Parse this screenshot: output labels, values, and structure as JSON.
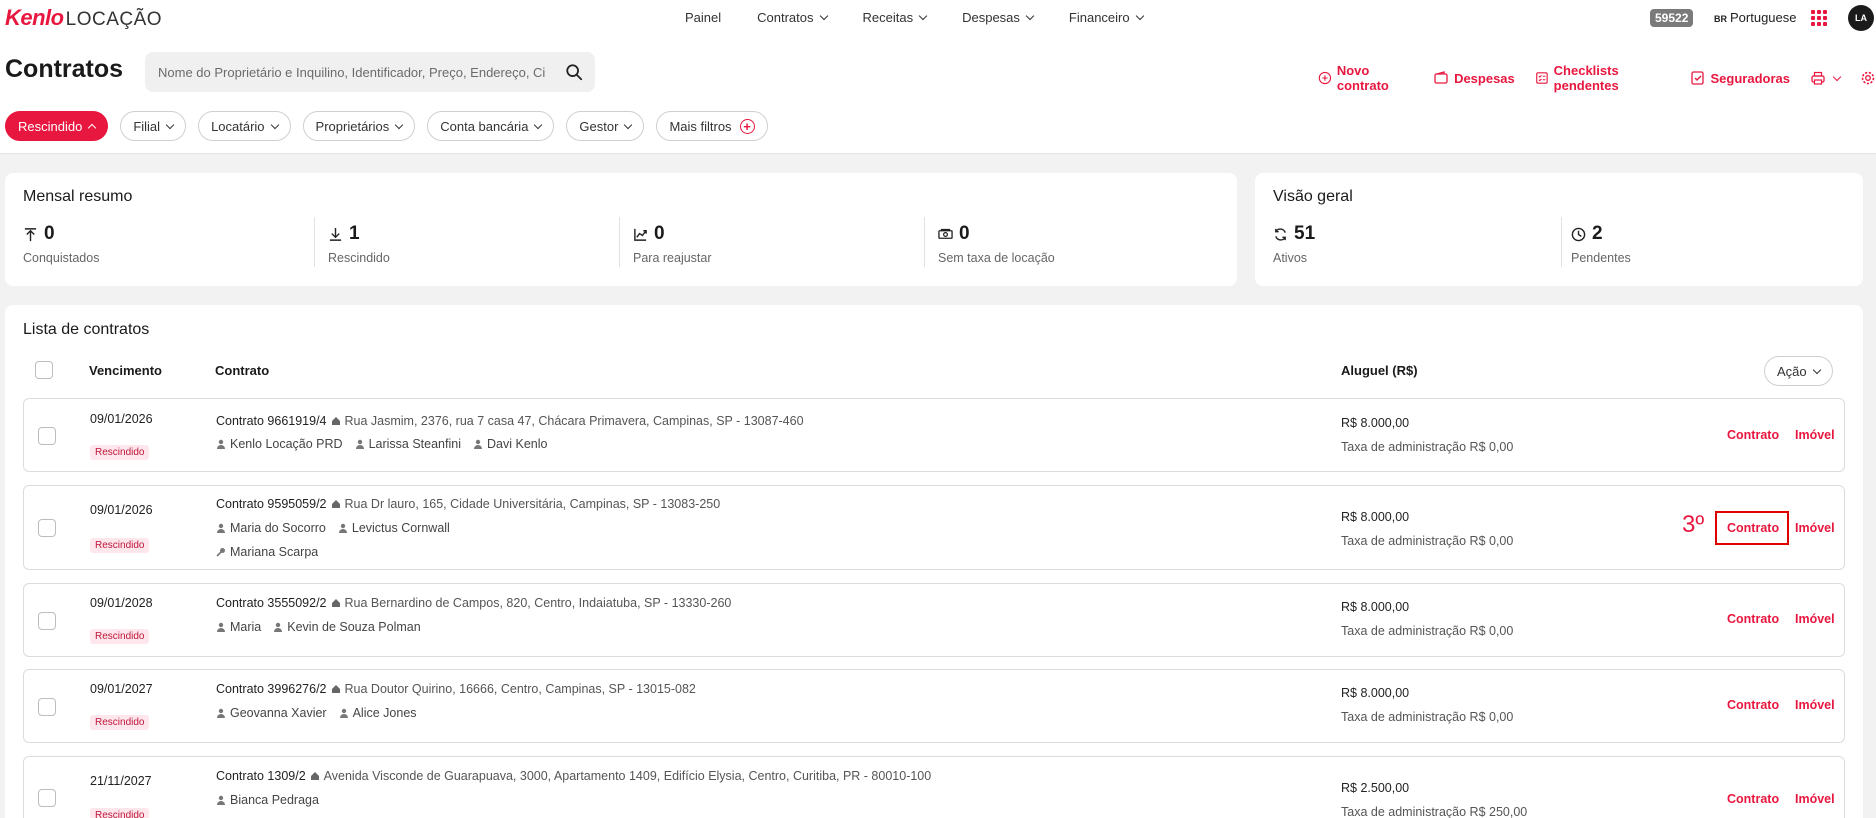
{
  "brand": {
    "logo_part1": "Kenlo",
    "logo_part2": "LOCAÇÃO"
  },
  "nav": [
    "Painel",
    "Contratos",
    "Receitas",
    "Despesas",
    "Financeiro"
  ],
  "account": {
    "id": "59522",
    "lang_code": "BR",
    "lang": "Portuguese",
    "avatar": "LA"
  },
  "page": {
    "title": "Contratos",
    "search_placeholder": "Nome do Proprietário e Inquilino, Identificador, Preço, Endereço, Cidade",
    "actions": [
      "Novo contrato",
      "Despesas",
      "Checklists pendentes",
      "Seguradoras"
    ]
  },
  "filters": [
    "Rescindido",
    "Filial",
    "Locatário",
    "Proprietários",
    "Conta bancária",
    "Gestor",
    "Mais filtros"
  ],
  "summary": {
    "title": "Mensal resumo",
    "stats": [
      {
        "value": "0",
        "label": "Conquistados",
        "icon": "arrow-up-bar-icon"
      },
      {
        "value": "1",
        "label": "Rescindido",
        "icon": "download-icon"
      },
      {
        "value": "0",
        "label": "Para reajustar",
        "icon": "trend-up-icon"
      },
      {
        "value": "0",
        "label": "Sem taxa de locação",
        "icon": "money-icon"
      }
    ]
  },
  "overview": {
    "title": "Visão geral",
    "stats": [
      {
        "value": "51",
        "label": "Ativos",
        "icon": "refresh-icon"
      },
      {
        "value": "2",
        "label": "Pendentes",
        "icon": "clock-icon"
      }
    ]
  },
  "list": {
    "title": "Lista de contratos",
    "headers": {
      "due": "Vencimento",
      "contract": "Contrato",
      "rent": "Aluguel (R$)"
    },
    "action_label": "Ação",
    "link_contract": "Contrato",
    "link_property": "Imóvel",
    "rows": [
      {
        "date": "09/01/2026",
        "status": "Rescindido",
        "contract": "Contrato 9661919/4",
        "address": "Rua Jasmim, 2376, rua 7 casa 47, Chácara Primavera, Campinas, SP - 13087-460",
        "people": [
          "Kenlo Locação PRD",
          "Larissa Steanfini",
          "Davi Kenlo"
        ],
        "extra": "",
        "rent": "R$ 8.000,00",
        "fee": "Taxa de administração R$ 0,00"
      },
      {
        "date": "09/01/2026",
        "status": "Rescindido",
        "contract": "Contrato 9595059/2",
        "address": "Rua Dr lauro, 165, Cidade Universitária, Campinas, SP - 13083-250",
        "people": [
          "Maria do Socorro",
          "Levictus Cornwall"
        ],
        "extra": "Mariana Scarpa",
        "rent": "R$ 8.000,00",
        "fee": "Taxa de administração R$ 0,00"
      },
      {
        "date": "09/01/2028",
        "status": "Rescindido",
        "contract": "Contrato 3555092/2",
        "address": "Rua Bernardino de Campos, 820, Centro, Indaiatuba, SP - 13330-260",
        "people": [
          "Maria",
          "Kevin de Souza Polman"
        ],
        "extra": "",
        "rent": "R$ 8.000,00",
        "fee": "Taxa de administração R$ 0,00"
      },
      {
        "date": "09/01/2027",
        "status": "Rescindido",
        "contract": "Contrato 3996276/2",
        "address": "Rua Doutor Quirino, 16666, Centro, Campinas, SP - 13015-082",
        "people": [
          "Geovanna Xavier",
          "Alice Jones"
        ],
        "extra": "",
        "rent": "R$ 8.000,00",
        "fee": "Taxa de administração R$ 0,00"
      },
      {
        "date": "21/11/2027",
        "status": "Rescindido",
        "contract": "Contrato 1309/2",
        "address": "Avenida Visconde de Guarapuava, 3000, Apartamento 1409, Edifício Elysia, Centro, Curitiba, PR - 80010-100",
        "people": [
          "Bianca Pedraga"
        ],
        "extra": "",
        "rent": "R$ 2.500,00",
        "fee": "Taxa de administração R$ 250,00"
      }
    ]
  },
  "annotation": {
    "label": "3º"
  },
  "colors": {
    "accent": "#e8173f",
    "highlight": "#e00000"
  }
}
